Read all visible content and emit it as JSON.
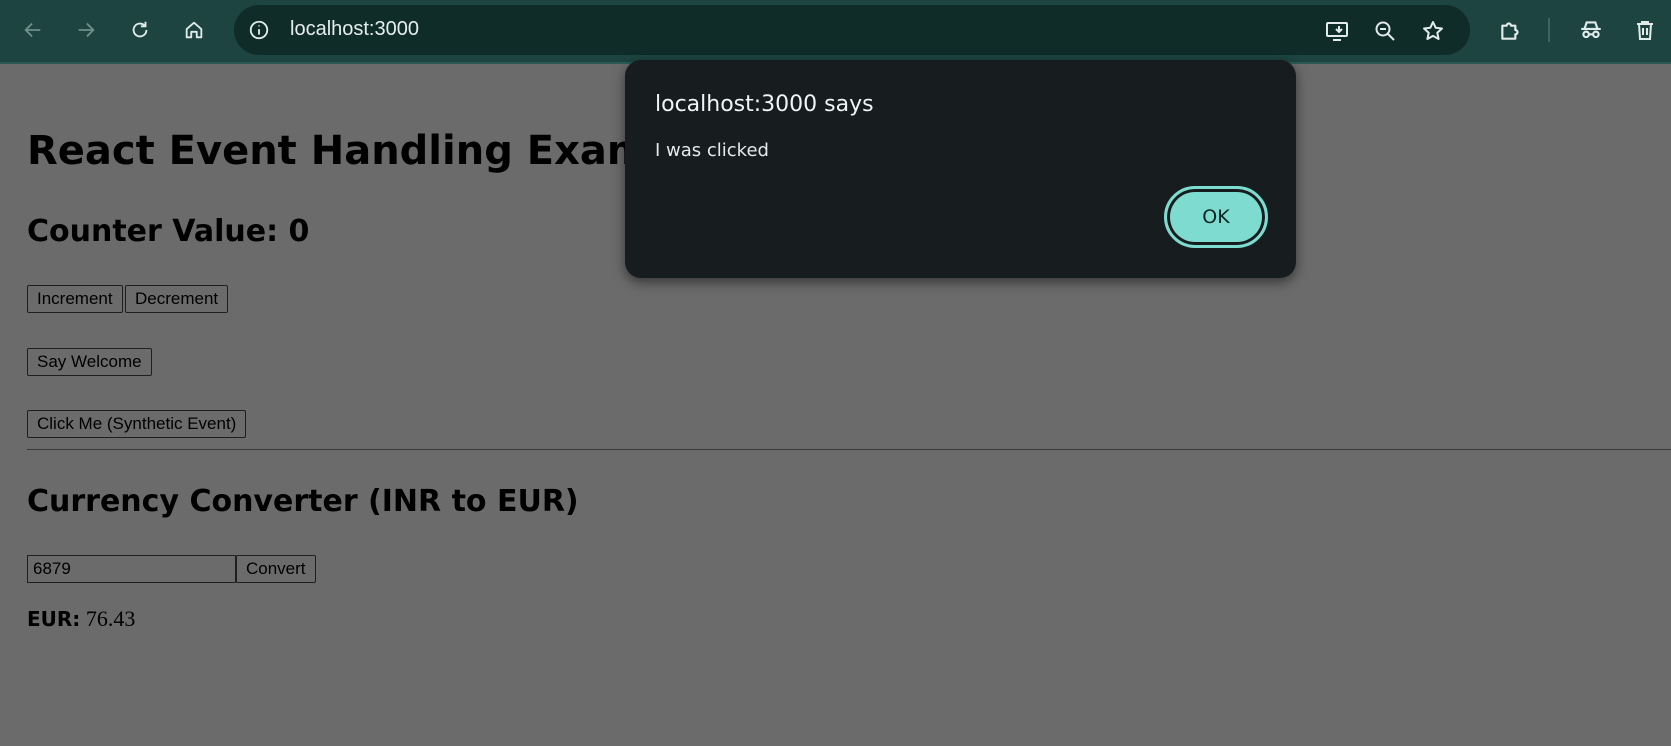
{
  "browser": {
    "url": "localhost:3000",
    "icons": {
      "back": "arrow-left-icon",
      "forward": "arrow-right-icon",
      "reload": "reload-icon",
      "home": "home-icon",
      "site_info": "info-icon",
      "install": "install-app-icon",
      "zoom": "zoom-out-icon",
      "bookmark": "star-icon",
      "extensions": "puzzle-icon",
      "incognito": "incognito-icon",
      "delete": "trash-icon"
    }
  },
  "page": {
    "title": "React Event Handling Example",
    "counter_label": "Counter Value: 0",
    "increment_label": "Increment",
    "decrement_label": "Decrement",
    "say_welcome_label": "Say Welcome",
    "synthetic_label": "Click Me (Synthetic Event)",
    "converter_title": "Currency Converter (INR to EUR)",
    "amount_value": "6879",
    "convert_label": "Convert",
    "result_label": "EUR:",
    "result_value": "76.43"
  },
  "dialog": {
    "title": "localhost:3000 says",
    "message": "I was clicked",
    "ok_label": "OK"
  },
  "colors": {
    "toolbar": "#1d4440",
    "omnibox": "#0f2c29",
    "dialog_bg": "#171d1e",
    "accent": "#7ddbd0",
    "page_dimmed": "#6b6b6b"
  }
}
